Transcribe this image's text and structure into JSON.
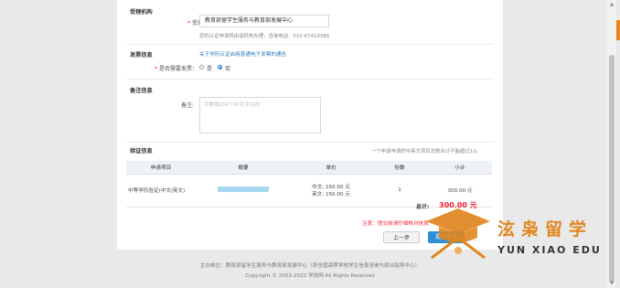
{
  "receiving": {
    "section_title": "受理机构",
    "label": "受理机构:",
    "value": "教育部留学生服务与教育部发展中心",
    "hint": "您的认证申请将由该机构办理，咨询电话：010-67410388"
  },
  "invoice": {
    "section_title": "发票信息",
    "link": "关于学历认证启用普通电子发票的通告",
    "label": "是否需要发票：",
    "options": [
      "是",
      "否"
    ],
    "selected": "否"
  },
  "remarks": {
    "section_title": "备注信息",
    "label": "备注:",
    "placeholder": "字数限200个中文字以内"
  },
  "verify": {
    "section_title": "验证信息",
    "note": "一个申请申请的中英文项目总数合计不能超过10。",
    "headers": [
      "申请项目",
      "概要",
      "单价",
      "份数",
      "小计"
    ],
    "row": {
      "item": "中等学历验证(中文/英文)",
      "price_cn": "中文: 150.00 元",
      "price_en": "英文: 150.00 元",
      "qty": "1",
      "subtotal": "300.00 元"
    },
    "total_label": "总计:",
    "total_value": "300.00 元"
  },
  "actions": {
    "note": "注意：提交前请仔细核对信息",
    "prev": "上一步",
    "next": "提交申请"
  },
  "footer": {
    "line1": "主办单位：教育部留学生服务与教育部发展中心（原全国高等学校学生信息咨询与就业指导中心）",
    "line2": "Copyright © 2003-2022 学信网 All Rights Reserved"
  },
  "watermark": {
    "name_cn": "泫枭留学",
    "name_en": "YUN XIAO EDU"
  }
}
